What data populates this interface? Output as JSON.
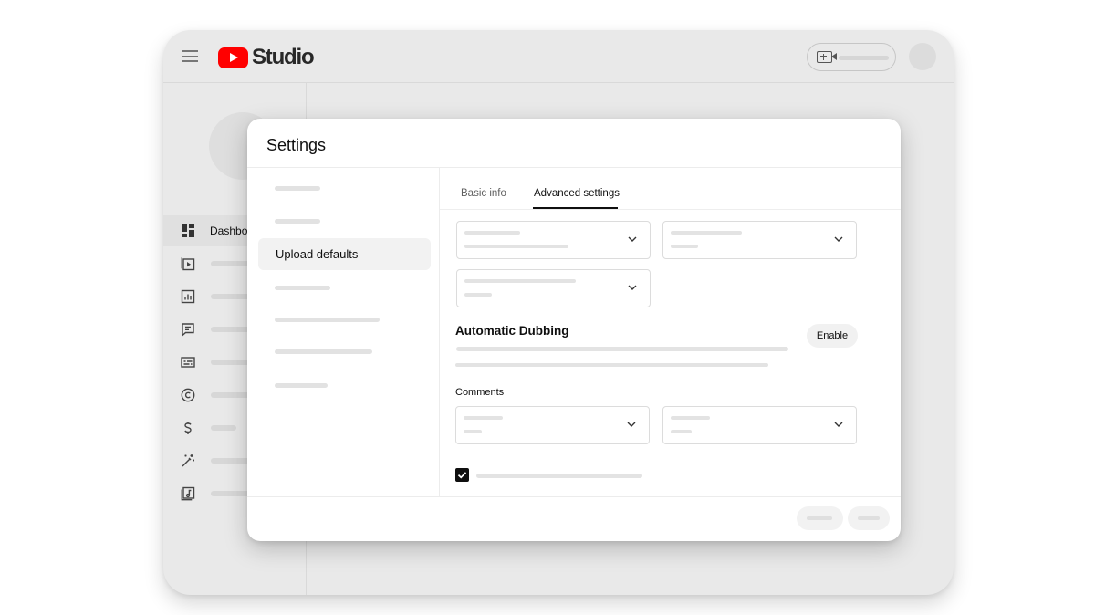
{
  "app": {
    "logo_text": "Studio",
    "brand_color": "#ff0000"
  },
  "sidebar": {
    "items": [
      {
        "icon": "dashboard-icon",
        "label": "Dashboa",
        "active": true
      },
      {
        "icon": "content-icon",
        "label": "",
        "active": false
      },
      {
        "icon": "analytics-icon",
        "label": "",
        "active": false
      },
      {
        "icon": "comments-icon",
        "label": "",
        "active": false
      },
      {
        "icon": "subtitles-icon",
        "label": "",
        "active": false
      },
      {
        "icon": "copyright-icon",
        "label": "",
        "active": false
      },
      {
        "icon": "monetization-icon",
        "label": "",
        "active": false
      },
      {
        "icon": "customization-icon",
        "label": "",
        "active": false
      },
      {
        "icon": "audio-library-icon",
        "label": "",
        "active": false
      }
    ]
  },
  "dialog": {
    "title": "Settings",
    "nav": {
      "active_label": "Upload defaults"
    },
    "tabs": [
      {
        "label": "Basic info",
        "selected": false
      },
      {
        "label": "Advanced settings",
        "selected": true
      }
    ],
    "dubbing": {
      "title": "Automatic Dubbing",
      "button_label": "Enable"
    },
    "comments": {
      "label": "Comments"
    },
    "checkbox": {
      "checked": true
    }
  }
}
